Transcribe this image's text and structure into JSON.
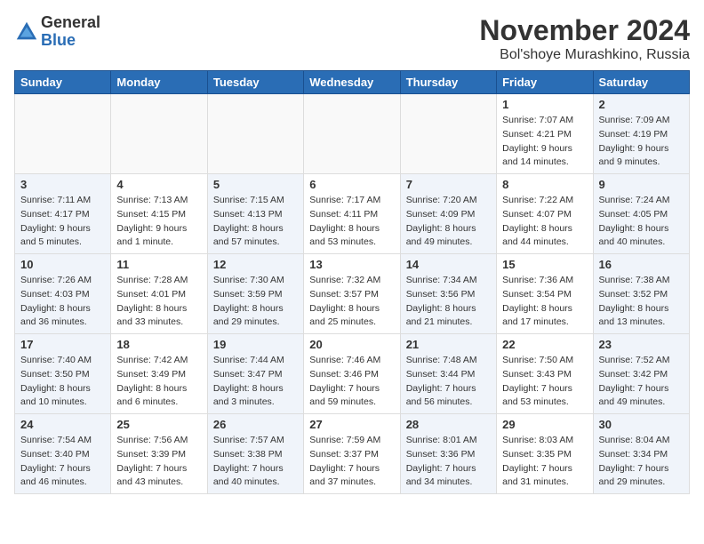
{
  "logo": {
    "general": "General",
    "blue": "Blue"
  },
  "title": {
    "month_year": "November 2024",
    "location": "Bol'shoye Murashkino, Russia"
  },
  "headers": [
    "Sunday",
    "Monday",
    "Tuesday",
    "Wednesday",
    "Thursday",
    "Friday",
    "Saturday"
  ],
  "weeks": [
    [
      {
        "day": "",
        "info": ""
      },
      {
        "day": "",
        "info": ""
      },
      {
        "day": "",
        "info": ""
      },
      {
        "day": "",
        "info": ""
      },
      {
        "day": "",
        "info": ""
      },
      {
        "day": "1",
        "info": "Sunrise: 7:07 AM\nSunset: 4:21 PM\nDaylight: 9 hours and 14 minutes."
      },
      {
        "day": "2",
        "info": "Sunrise: 7:09 AM\nSunset: 4:19 PM\nDaylight: 9 hours and 9 minutes."
      }
    ],
    [
      {
        "day": "3",
        "info": "Sunrise: 7:11 AM\nSunset: 4:17 PM\nDaylight: 9 hours and 5 minutes."
      },
      {
        "day": "4",
        "info": "Sunrise: 7:13 AM\nSunset: 4:15 PM\nDaylight: 9 hours and 1 minute."
      },
      {
        "day": "5",
        "info": "Sunrise: 7:15 AM\nSunset: 4:13 PM\nDaylight: 8 hours and 57 minutes."
      },
      {
        "day": "6",
        "info": "Sunrise: 7:17 AM\nSunset: 4:11 PM\nDaylight: 8 hours and 53 minutes."
      },
      {
        "day": "7",
        "info": "Sunrise: 7:20 AM\nSunset: 4:09 PM\nDaylight: 8 hours and 49 minutes."
      },
      {
        "day": "8",
        "info": "Sunrise: 7:22 AM\nSunset: 4:07 PM\nDaylight: 8 hours and 44 minutes."
      },
      {
        "day": "9",
        "info": "Sunrise: 7:24 AM\nSunset: 4:05 PM\nDaylight: 8 hours and 40 minutes."
      }
    ],
    [
      {
        "day": "10",
        "info": "Sunrise: 7:26 AM\nSunset: 4:03 PM\nDaylight: 8 hours and 36 minutes."
      },
      {
        "day": "11",
        "info": "Sunrise: 7:28 AM\nSunset: 4:01 PM\nDaylight: 8 hours and 33 minutes."
      },
      {
        "day": "12",
        "info": "Sunrise: 7:30 AM\nSunset: 3:59 PM\nDaylight: 8 hours and 29 minutes."
      },
      {
        "day": "13",
        "info": "Sunrise: 7:32 AM\nSunset: 3:57 PM\nDaylight: 8 hours and 25 minutes."
      },
      {
        "day": "14",
        "info": "Sunrise: 7:34 AM\nSunset: 3:56 PM\nDaylight: 8 hours and 21 minutes."
      },
      {
        "day": "15",
        "info": "Sunrise: 7:36 AM\nSunset: 3:54 PM\nDaylight: 8 hours and 17 minutes."
      },
      {
        "day": "16",
        "info": "Sunrise: 7:38 AM\nSunset: 3:52 PM\nDaylight: 8 hours and 13 minutes."
      }
    ],
    [
      {
        "day": "17",
        "info": "Sunrise: 7:40 AM\nSunset: 3:50 PM\nDaylight: 8 hours and 10 minutes."
      },
      {
        "day": "18",
        "info": "Sunrise: 7:42 AM\nSunset: 3:49 PM\nDaylight: 8 hours and 6 minutes."
      },
      {
        "day": "19",
        "info": "Sunrise: 7:44 AM\nSunset: 3:47 PM\nDaylight: 8 hours and 3 minutes."
      },
      {
        "day": "20",
        "info": "Sunrise: 7:46 AM\nSunset: 3:46 PM\nDaylight: 7 hours and 59 minutes."
      },
      {
        "day": "21",
        "info": "Sunrise: 7:48 AM\nSunset: 3:44 PM\nDaylight: 7 hours and 56 minutes."
      },
      {
        "day": "22",
        "info": "Sunrise: 7:50 AM\nSunset: 3:43 PM\nDaylight: 7 hours and 53 minutes."
      },
      {
        "day": "23",
        "info": "Sunrise: 7:52 AM\nSunset: 3:42 PM\nDaylight: 7 hours and 49 minutes."
      }
    ],
    [
      {
        "day": "24",
        "info": "Sunrise: 7:54 AM\nSunset: 3:40 PM\nDaylight: 7 hours and 46 minutes."
      },
      {
        "day": "25",
        "info": "Sunrise: 7:56 AM\nSunset: 3:39 PM\nDaylight: 7 hours and 43 minutes."
      },
      {
        "day": "26",
        "info": "Sunrise: 7:57 AM\nSunset: 3:38 PM\nDaylight: 7 hours and 40 minutes."
      },
      {
        "day": "27",
        "info": "Sunrise: 7:59 AM\nSunset: 3:37 PM\nDaylight: 7 hours and 37 minutes."
      },
      {
        "day": "28",
        "info": "Sunrise: 8:01 AM\nSunset: 3:36 PM\nDaylight: 7 hours and 34 minutes."
      },
      {
        "day": "29",
        "info": "Sunrise: 8:03 AM\nSunset: 3:35 PM\nDaylight: 7 hours and 31 minutes."
      },
      {
        "day": "30",
        "info": "Sunrise: 8:04 AM\nSunset: 3:34 PM\nDaylight: 7 hours and 29 minutes."
      }
    ]
  ]
}
